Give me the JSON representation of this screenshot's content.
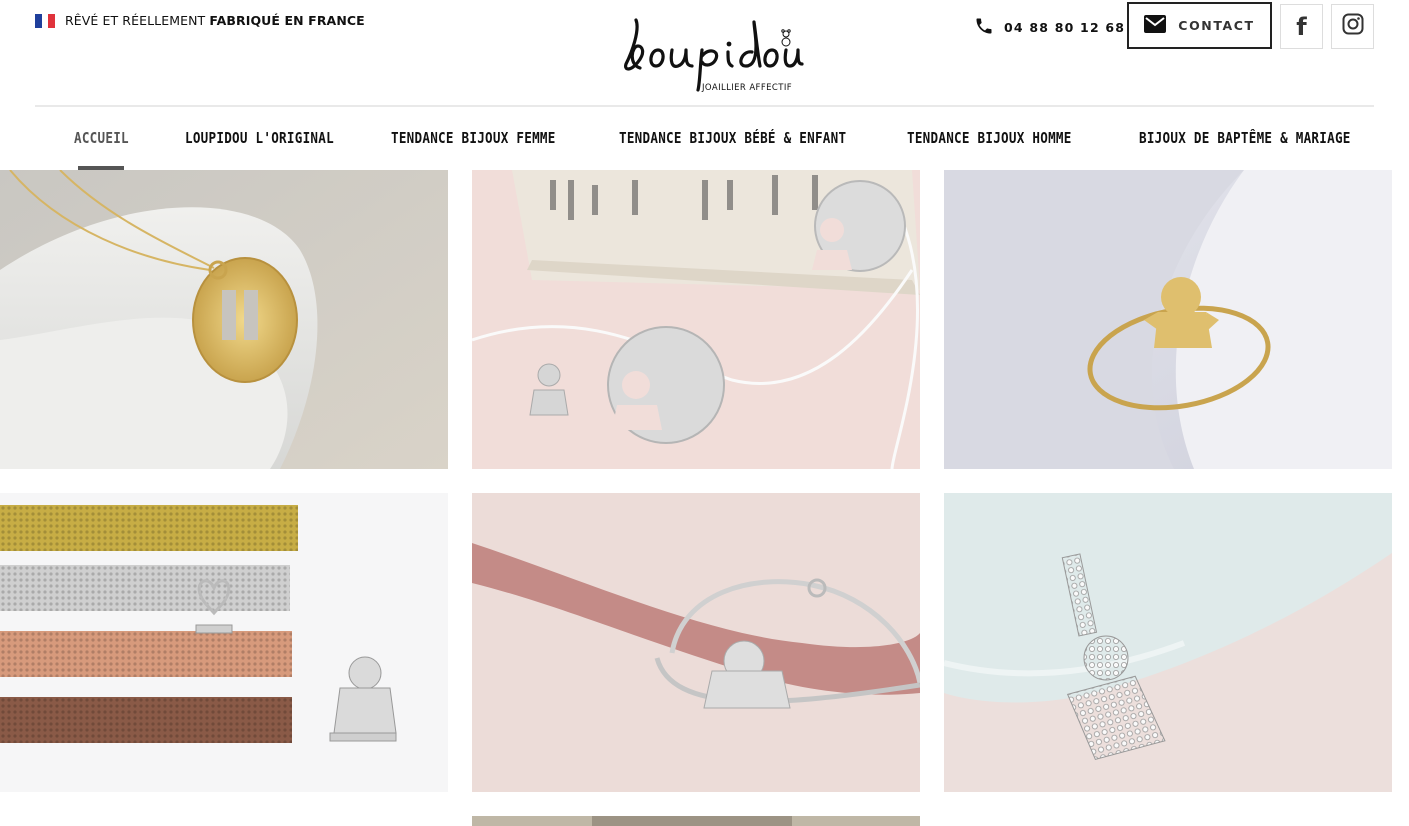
{
  "topbar": {
    "tagline_prefix": "RÊVÉ ET RÉELLEMENT",
    "tagline_bold": "FABRIQUÉ EN FRANCE",
    "flag_colors": [
      "#1f3f9c",
      "#ffffff",
      "#e0333c"
    ],
    "phone": "04 88 80 12 68",
    "contact_label": "CONTACT",
    "facebook_glyph": "f"
  },
  "brand": {
    "logo_text": "Loupidou",
    "tagline": "JOAILLIER AFFECTIF"
  },
  "nav": {
    "items": [
      {
        "label": "ACCUEIL",
        "active": true
      },
      {
        "label": "LOUPIDOU L'ORIGINAL",
        "active": false
      },
      {
        "label": "TENDANCE BIJOUX FEMME",
        "active": false
      },
      {
        "label": "TENDANCE BIJOUX BÉBÉ & ENFANT",
        "active": false
      },
      {
        "label": "TENDANCE BIJOUX HOMME",
        "active": false
      },
      {
        "label": "BIJOUX DE BAPTÊME & MARIAGE",
        "active": false
      }
    ]
  },
  "gallery": {
    "tiles": [
      "gold-pendant-photo",
      "silver-kid-pendants-photo",
      "gold-ring-photo",
      "mesh-bracelets-photo",
      "silver-bangle-ribbon-photo",
      "diamond-kid-pendant-photo",
      "partial-photo"
    ]
  },
  "icons": [
    "flag-fr-icon",
    "phone-icon",
    "mail-icon",
    "facebook-icon",
    "instagram-icon"
  ],
  "colors": {
    "text": "#111111",
    "active_nav": "#555555",
    "border": "#222222"
  }
}
